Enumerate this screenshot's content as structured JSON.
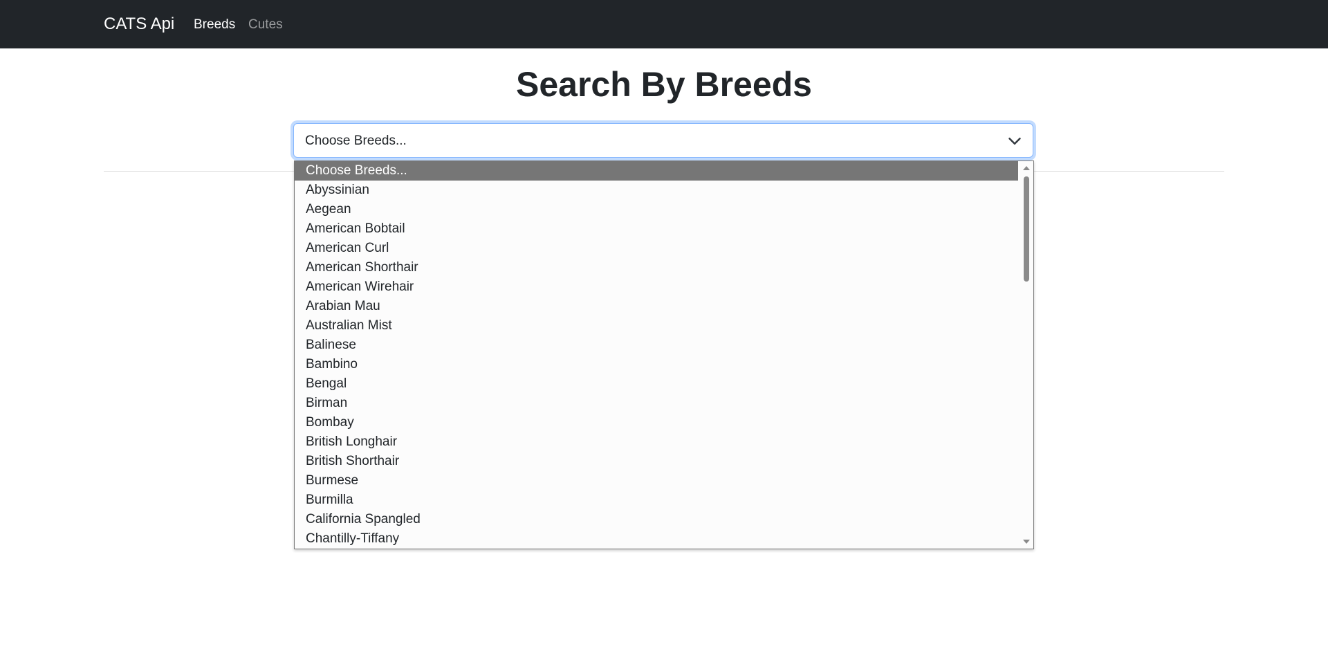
{
  "navbar": {
    "brand": "CATS Api",
    "links": [
      "Breeds",
      "Cutes"
    ],
    "active_color": "#ffffff",
    "inactive_color": "#8c8f91",
    "background": "#212529"
  },
  "main": {
    "title": "Search By Breeds"
  },
  "breed_select": {
    "value": "Choose Breeds...",
    "icon": "chevron-down-icon",
    "focus_color": "#86b7fe"
  },
  "dropdown": {
    "selected_index": 0,
    "selected_background": "#767676",
    "options": [
      "Choose Breeds...",
      "Abyssinian",
      "Aegean",
      "American Bobtail",
      "American Curl",
      "American Shorthair",
      "American Wirehair",
      "Arabian Mau",
      "Australian Mist",
      "Balinese",
      "Bambino",
      "Bengal",
      "Birman",
      "Bombay",
      "British Longhair",
      "British Shorthair",
      "Burmese",
      "Burmilla",
      "California Spangled",
      "Chantilly-Tiffany"
    ]
  }
}
